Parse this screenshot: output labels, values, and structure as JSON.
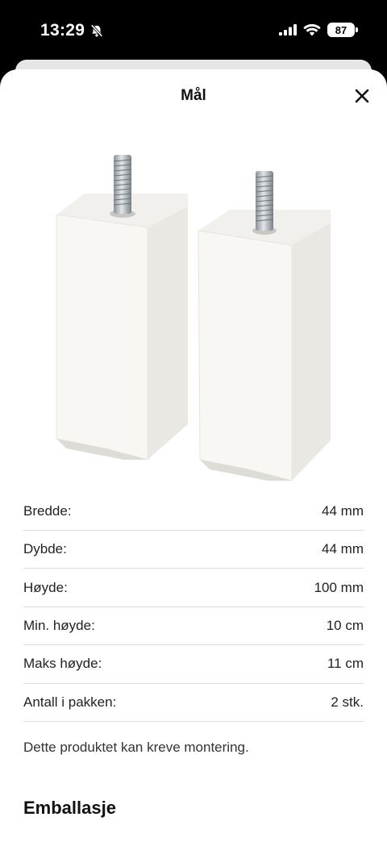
{
  "status": {
    "time": "13:29",
    "battery": "87",
    "battery_level": 0.87
  },
  "sheet": {
    "title": "Mål",
    "close_icon": "close-icon"
  },
  "dimensions": [
    {
      "label": "Bredde:",
      "value": "44 mm"
    },
    {
      "label": "Dybde:",
      "value": "44 mm"
    },
    {
      "label": "Høyde:",
      "value": "100 mm"
    },
    {
      "label": "Min. høyde:",
      "value": "10 cm"
    },
    {
      "label": "Maks høyde:",
      "value": "11 cm"
    },
    {
      "label": "Antall i pakken:",
      "value": "2 stk."
    }
  ],
  "note": "Dette produktet kan kreve montering.",
  "packaging_title": "Emballasje"
}
